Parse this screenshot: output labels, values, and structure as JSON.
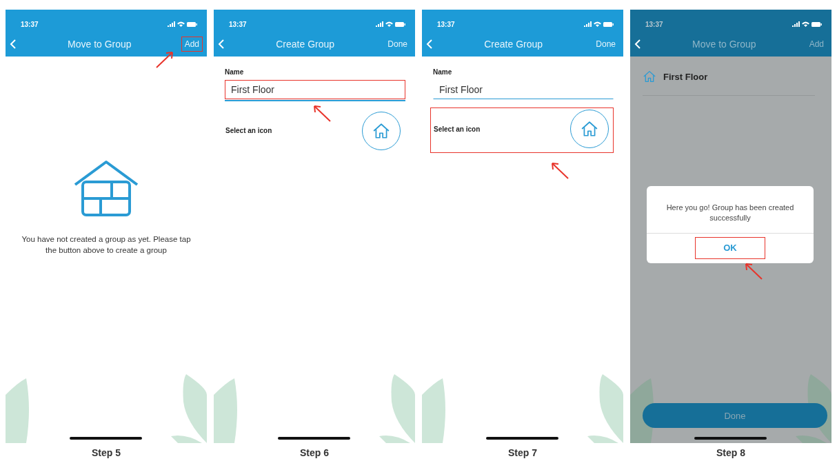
{
  "steps": [
    {
      "kind": "empty",
      "status_time": "13:37",
      "title": "Move to Group",
      "action": {
        "label": "Add",
        "highlighted": true
      },
      "empty_message": "You have not created a group as yet. Please tap the button above to create a group",
      "caption": "Step 5"
    },
    {
      "kind": "form",
      "status_time": "13:37",
      "title": "Create Group",
      "action": {
        "label": "Done",
        "highlighted": false
      },
      "name_label": "Name",
      "name_value": "First Floor",
      "name_highlighted": true,
      "icon_label": "Select an icon",
      "icon_highlighted": false,
      "caption": "Step 6"
    },
    {
      "kind": "form",
      "status_time": "13:37",
      "title": "Create Group",
      "action": {
        "label": "Done",
        "highlighted": false
      },
      "name_label": "Name",
      "name_value": "First Floor",
      "name_highlighted": false,
      "icon_label": "Select an icon",
      "icon_highlighted": true,
      "caption": "Step 7"
    },
    {
      "kind": "list",
      "status_time": "13:37",
      "title": "Move to Group",
      "action": {
        "label": "Add",
        "highlighted": false
      },
      "groups": [
        {
          "name": "First Floor"
        }
      ],
      "dialog": {
        "message": "Here you go! Group has been created successfully",
        "button": "OK",
        "button_highlighted": true
      },
      "done_button": "Done",
      "caption": "Step 8"
    }
  ]
}
